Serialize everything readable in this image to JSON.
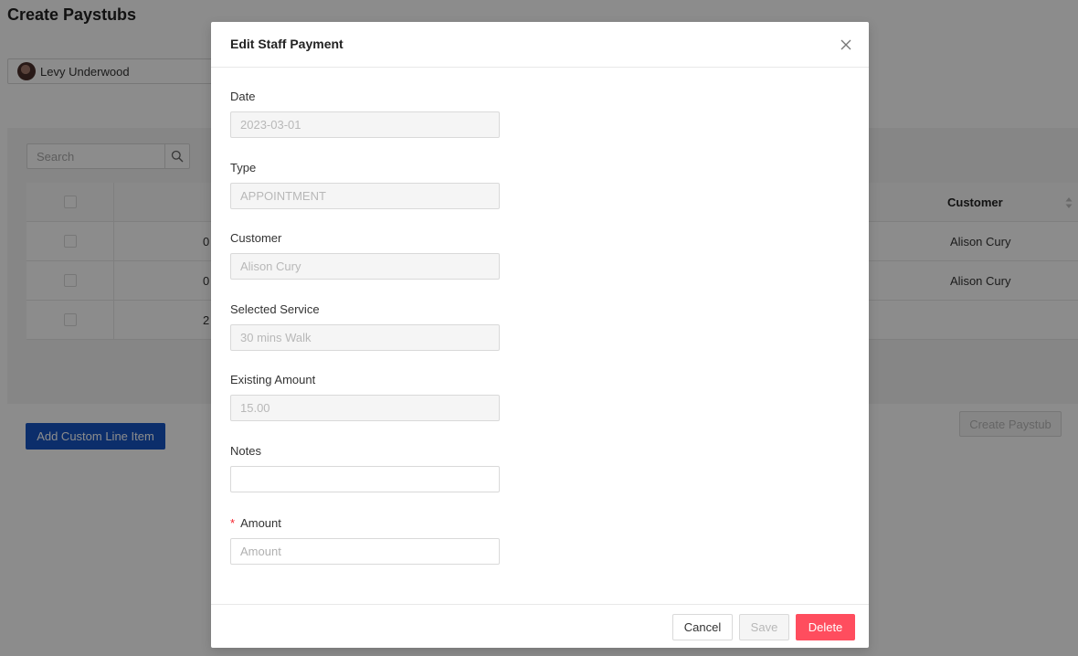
{
  "page": {
    "title": "Create Paystubs",
    "staff_select": {
      "value": "Levy Underwood"
    },
    "search": {
      "placeholder": "Search"
    },
    "table": {
      "columns": {
        "customer": "Customer"
      },
      "rows": [
        {
          "date_fragment": "0",
          "customer": "Alison Cury"
        },
        {
          "date_fragment": "0",
          "customer": "Alison Cury"
        },
        {
          "date_fragment": "2",
          "customer": ""
        }
      ]
    },
    "add_custom_line_item_label": "Add Custom Line Item",
    "create_paystub_label": "Create Paystub"
  },
  "modal": {
    "title": "Edit Staff Payment",
    "fields": {
      "date": {
        "label": "Date",
        "value": "2023-03-01"
      },
      "type": {
        "label": "Type",
        "value": "APPOINTMENT"
      },
      "customer": {
        "label": "Customer",
        "value": "Alison Cury"
      },
      "service": {
        "label": "Selected Service",
        "value": "30 mins Walk"
      },
      "existing_amount": {
        "label": "Existing Amount",
        "value": "15.00"
      },
      "notes": {
        "label": "Notes",
        "value": ""
      },
      "amount": {
        "label": "Amount",
        "required_mark": "*",
        "placeholder": "Amount"
      }
    },
    "footer": {
      "cancel_label": "Cancel",
      "save_label": "Save",
      "delete_label": "Delete"
    }
  },
  "colors": {
    "primary_button": "#1755c4",
    "delete_button": "#ff4d5e",
    "required_mark": "#f5222d",
    "overlay": "rgba(0,0,0,0.45)"
  },
  "icons": {
    "avatar": "avatar",
    "search": "search-icon",
    "sort": "sort-icon",
    "close": "close-icon"
  }
}
